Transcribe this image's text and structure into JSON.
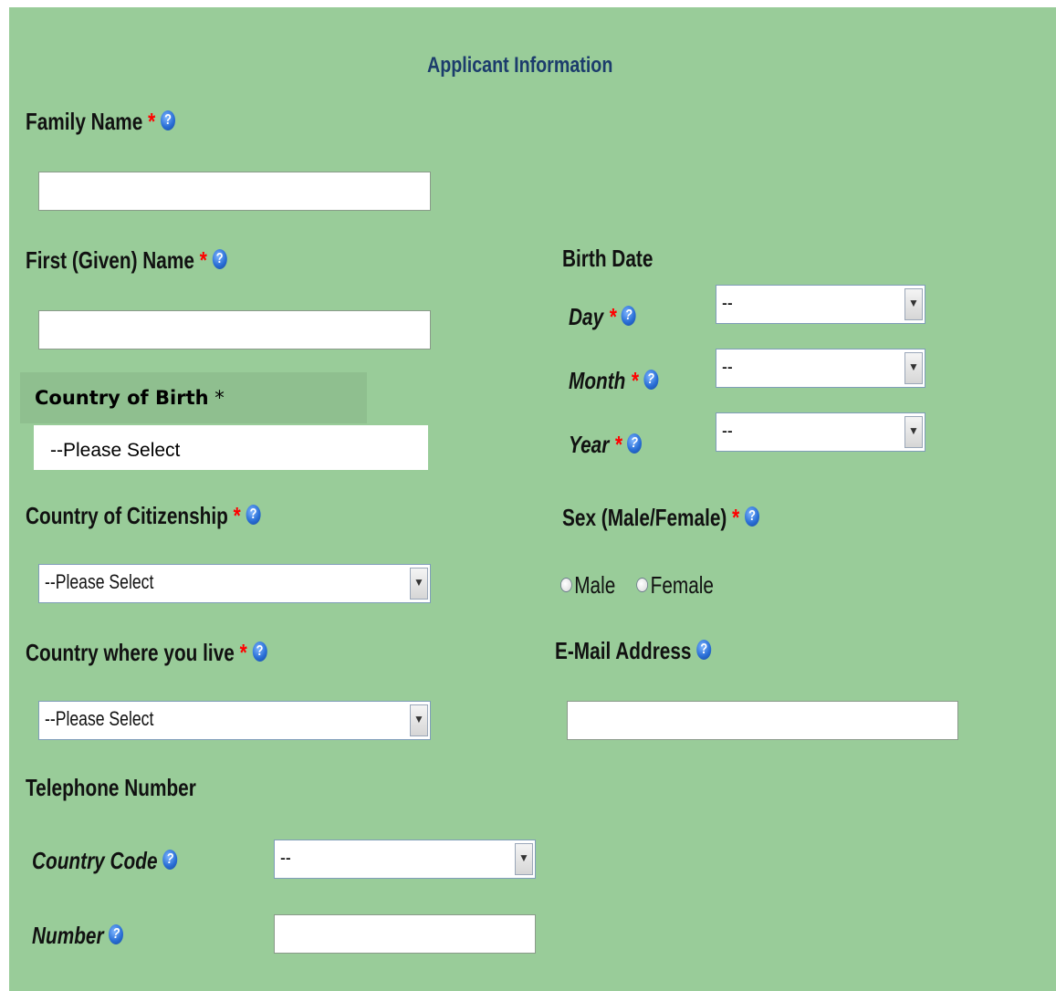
{
  "form": {
    "section_title": "Applicant Information",
    "required_mark": "*",
    "help_glyph": "?",
    "family_name": {
      "label": "Family Name",
      "value": ""
    },
    "first_name": {
      "label": "First (Given) Name",
      "value": ""
    },
    "country_of_birth": {
      "label": "Country of Birth",
      "required_mark": "*",
      "selected": "--Please Select"
    },
    "country_of_citizenship": {
      "label": "Country of Citizenship",
      "selected": "--Please Select"
    },
    "country_where_you_live": {
      "label": "Country where you live",
      "selected": "--Please Select"
    },
    "telephone": {
      "heading": "Telephone Number",
      "country_code": {
        "label": "Country Code",
        "selected": "--"
      },
      "number": {
        "label": "Number",
        "value": ""
      }
    },
    "birth_date": {
      "heading": "Birth Date",
      "day": {
        "label": "Day",
        "selected": "--"
      },
      "month": {
        "label": "Month",
        "selected": "--"
      },
      "year": {
        "label": "Year",
        "selected": "--"
      }
    },
    "sex": {
      "label": "Sex (Male/Female)",
      "options": [
        "Male",
        "Female"
      ],
      "selected": ""
    },
    "email": {
      "label": "E-Mail Address",
      "value": ""
    }
  },
  "icons": {
    "help": "help-icon",
    "dropdown": "chevron-down-icon",
    "help_color": "#2a6fd6",
    "required_color": "#ff0000",
    "panel_color": "#99cc99"
  }
}
